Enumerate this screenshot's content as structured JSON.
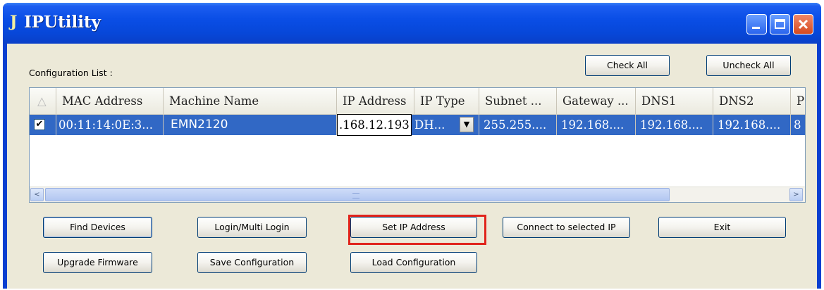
{
  "window": {
    "title": "IPUtility",
    "app_icon": "J"
  },
  "title_buttons": {
    "minimize": "minimize-icon",
    "maximize": "maximize-icon",
    "close": "close-icon"
  },
  "config_label": "Configuration List :",
  "top_buttons": {
    "check_all": "Check All",
    "uncheck_all": "Uncheck All"
  },
  "table": {
    "sort_indicator": "△",
    "columns": [
      "MAC Address",
      "Machine Name",
      "IP Address",
      "IP Type",
      "Subnet ...",
      "Gateway ...",
      "DNS1",
      "DNS2",
      "P"
    ],
    "rows": [
      {
        "checked": true,
        "check_glyph": "✔",
        "mac": "00:11:14:0E:3...",
        "machine": "EMN2120",
        "ip": ".168.12.193",
        "ip_type": "DH...",
        "subnet": "255.255....",
        "gateway": "192.168....",
        "dns1": "192.168....",
        "dns2": "192.168....",
        "p": "8"
      }
    ]
  },
  "scroll": {
    "left": "<",
    "right": ">"
  },
  "buttons": {
    "find_devices": "Find Devices",
    "login_multi": "Login/Multi Login",
    "set_ip": "Set IP Address",
    "connect": "Connect to selected IP",
    "exit": "Exit",
    "upgrade": "Upgrade Firmware",
    "save_config": "Save Configuration",
    "load_config": "Load Configuration"
  },
  "colors": {
    "title_bar": "#0a4ee6",
    "selection": "#3168c5",
    "highlight_box": "#e0241c",
    "client": "#ece9d8"
  }
}
